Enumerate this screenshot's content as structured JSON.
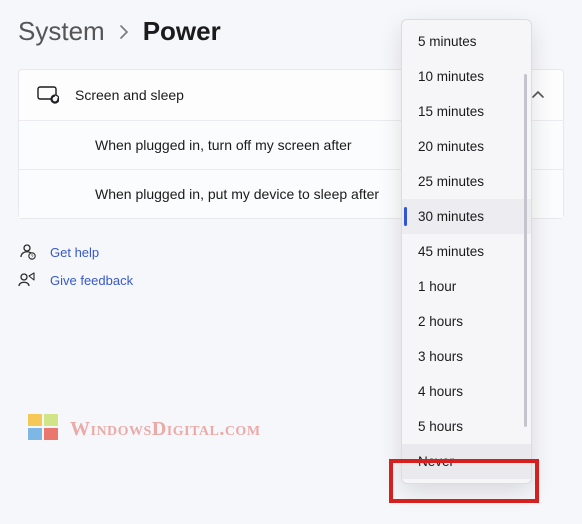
{
  "breadcrumb": {
    "parent": "System",
    "current": "Power"
  },
  "panel": {
    "title": "Screen and sleep",
    "rows": [
      "When plugged in, turn off my screen after",
      "When plugged in, put my device to sleep after"
    ]
  },
  "links": {
    "help": "Get help",
    "feedback": "Give feedback"
  },
  "watermark": "WindowsDigital.com",
  "dropdown": {
    "options": [
      "5 minutes",
      "10 minutes",
      "15 minutes",
      "20 minutes",
      "25 minutes",
      "30 minutes",
      "45 minutes",
      "1 hour",
      "2 hours",
      "3 hours",
      "4 hours",
      "5 hours",
      "Never"
    ],
    "selected_index": 5,
    "hover_index": 12
  }
}
